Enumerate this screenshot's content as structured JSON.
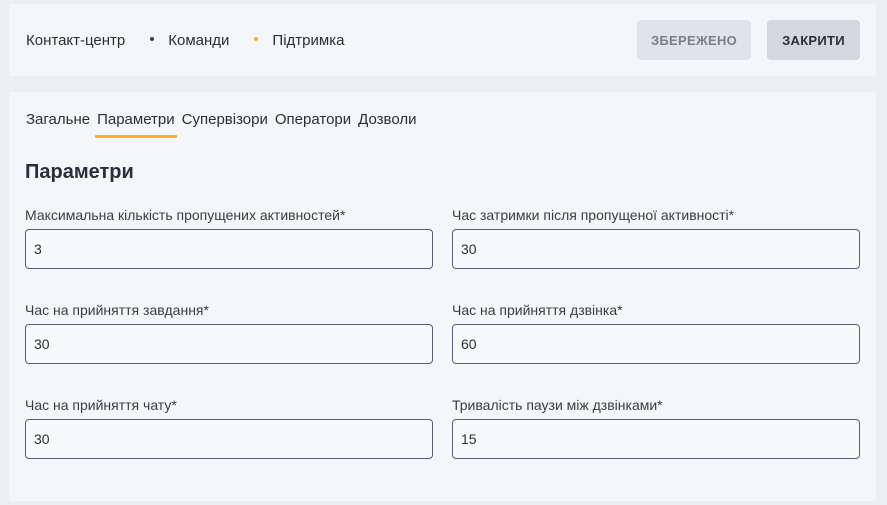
{
  "breadcrumb": {
    "items": [
      {
        "label": "Контакт-центр"
      },
      {
        "label": "Команди",
        "dot_color": "#3a3b5a"
      },
      {
        "label": "Підтримка",
        "dot_color": "#f2b51e"
      }
    ]
  },
  "header": {
    "saved_label": "ЗБЕРЕЖЕНО",
    "close_label": "ЗАКРИТИ"
  },
  "tabs": [
    {
      "label": "Загальне",
      "active": false
    },
    {
      "label": "Параметри",
      "active": true
    },
    {
      "label": "Супервізори",
      "active": false
    },
    {
      "label": "Оператори",
      "active": false
    },
    {
      "label": "Дозволи",
      "active": false
    }
  ],
  "section": {
    "title": "Параметри"
  },
  "fields": [
    {
      "label": "Максимальна кількість пропущених активностей*",
      "value": "3"
    },
    {
      "label": "Час затримки після пропущеної активності*",
      "value": "30"
    },
    {
      "label": "Час на прийняття завдання*",
      "value": "30"
    },
    {
      "label": "Час на прийняття дзвінка*",
      "value": "60"
    },
    {
      "label": "Час на прийняття чату*",
      "value": "30"
    },
    {
      "label": "Тривалість паузи між дзвінками*",
      "value": "15"
    }
  ],
  "colors": {
    "accent": "#f2b51e",
    "input_border": "#5b5b78"
  }
}
